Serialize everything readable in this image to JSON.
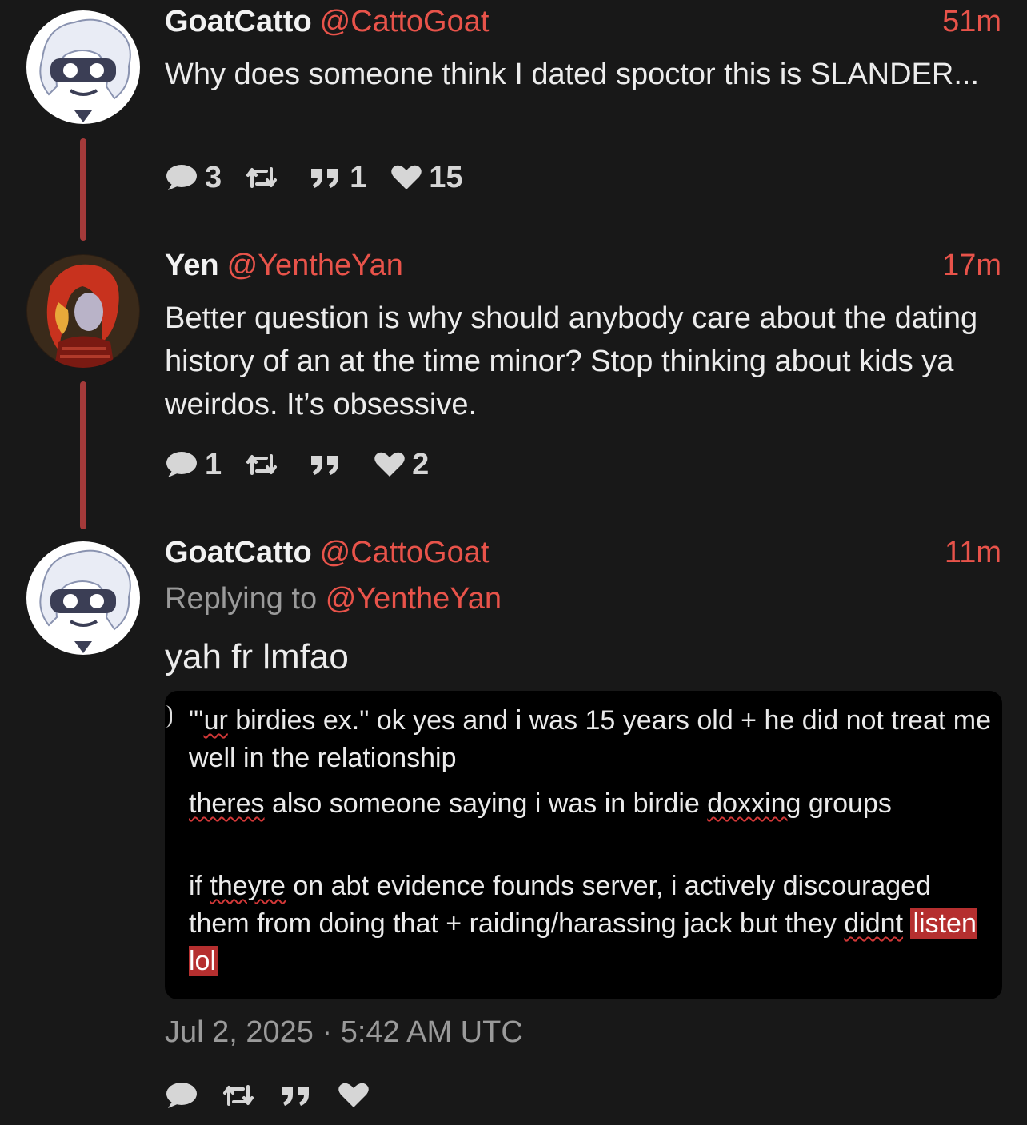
{
  "posts": [
    {
      "name": "GoatCatto",
      "handle": "@CattoGoat",
      "time": "51m",
      "text": "Why does someone think I dated spoctor this is SLANDER...",
      "replies": "3",
      "reposts": "",
      "quotes": "1",
      "likes": "15"
    },
    {
      "name": "Yen",
      "handle": "@YentheYan",
      "time": "17m",
      "text": "Better question is why should anybody care about the dating history of an at the time minor? Stop thinking about kids ya weirdos. It’s obsessive.",
      "replies": "1",
      "reposts": "",
      "quotes": "",
      "likes": "2"
    },
    {
      "name": "GoatCatto",
      "handle": "@CattoGoat",
      "time": "11m",
      "replying_label": "Replying to",
      "replying_handle": "@YentheYan",
      "text": "yah fr lmfao",
      "date": "Jul 2, 2025 · 5:42 AM UTC"
    }
  ],
  "screenshot": {
    "p1_a": "\"'",
    "p1_b": "ur",
    "p1_c": " birdies ex.\" ok yes and i was 15 years old + he did not treat me well in the relationship",
    "p2_a": "theres",
    "p2_b": " also someone saying i was in birdie ",
    "p2_c": "doxxing",
    "p2_d": " groups",
    "p3_a": "if ",
    "p3_b": "theyre",
    "p3_c": " on abt evidence founds server, i actively discouraged them from doing that + raiding/harassing jack but they ",
    "p3_d": "didnt",
    "p3_e": " ",
    "p3_f": "listen lol"
  },
  "colors": {
    "background": "#181818",
    "accent": "#e8534a",
    "thread_line": "#a43a3a",
    "muted": "#9a9a9a"
  },
  "icons": [
    "reply-icon",
    "repost-icon",
    "quote-icon",
    "heart-icon"
  ]
}
